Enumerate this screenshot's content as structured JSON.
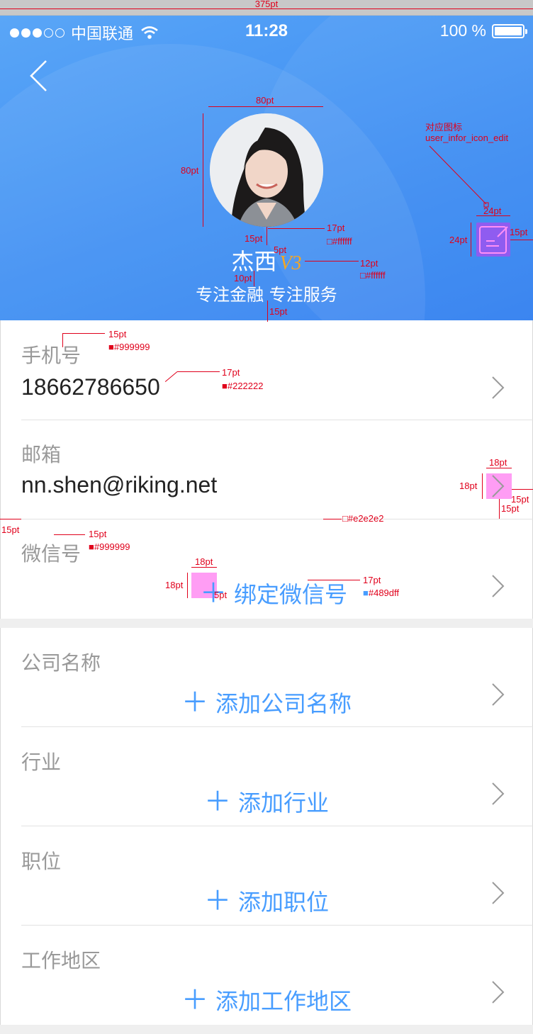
{
  "ruler": {
    "label": "375pt"
  },
  "status_bar": {
    "carrier": "中国联通",
    "time": "11:28",
    "battery": "100 %"
  },
  "profile": {
    "name": "杰西",
    "vip_badge": "V3",
    "motto": "专注金融 专注服务"
  },
  "fields": [
    {
      "label": "手机号",
      "value": "18662786650"
    },
    {
      "label": "邮箱",
      "value": "nn.shen@riking.net"
    },
    {
      "label": "微信号",
      "action": "绑定微信号"
    },
    {
      "label": "公司名称",
      "action": "添加公司名称"
    },
    {
      "label": "行业",
      "action": "添加行业"
    },
    {
      "label": "职位",
      "action": "添加职位"
    },
    {
      "label": "工作地区",
      "action": "添加工作地区"
    }
  ],
  "annotations": {
    "avatar_w": "80pt",
    "avatar_h": "80pt",
    "name_gap_top": "15pt",
    "name_size": "17pt",
    "name_color": "#ffffff",
    "name_badge_gap": "5pt",
    "motto_gap": "10pt",
    "motto_size": "12pt",
    "motto_color": "#ffffff",
    "header_bottom_gap": "15pt",
    "edit_icon_title": "对应图标",
    "edit_icon_name": "user_infor_icon_edit",
    "edit_w": "24pt",
    "edit_h": "24pt",
    "edit_right": "15pt",
    "label_size": "15pt",
    "label_color": "#999999",
    "value_size": "17pt",
    "value_color": "#222222",
    "chev_w": "18pt",
    "chev_h": "18pt",
    "chev_right": "15pt",
    "chev_bottom": "15pt",
    "divider_left": "15pt",
    "divider_color": "#e2e2e2",
    "wechat_label_size": "15pt",
    "wechat_label_color": "#999999",
    "plus_w": "18pt",
    "plus_h": "18pt",
    "plus_gap": "5pt",
    "action_size": "17pt",
    "action_color": "#489dff"
  },
  "colors": {
    "header": "#3f8ff3",
    "accent": "#489dff",
    "annotation": "#e0001b"
  }
}
